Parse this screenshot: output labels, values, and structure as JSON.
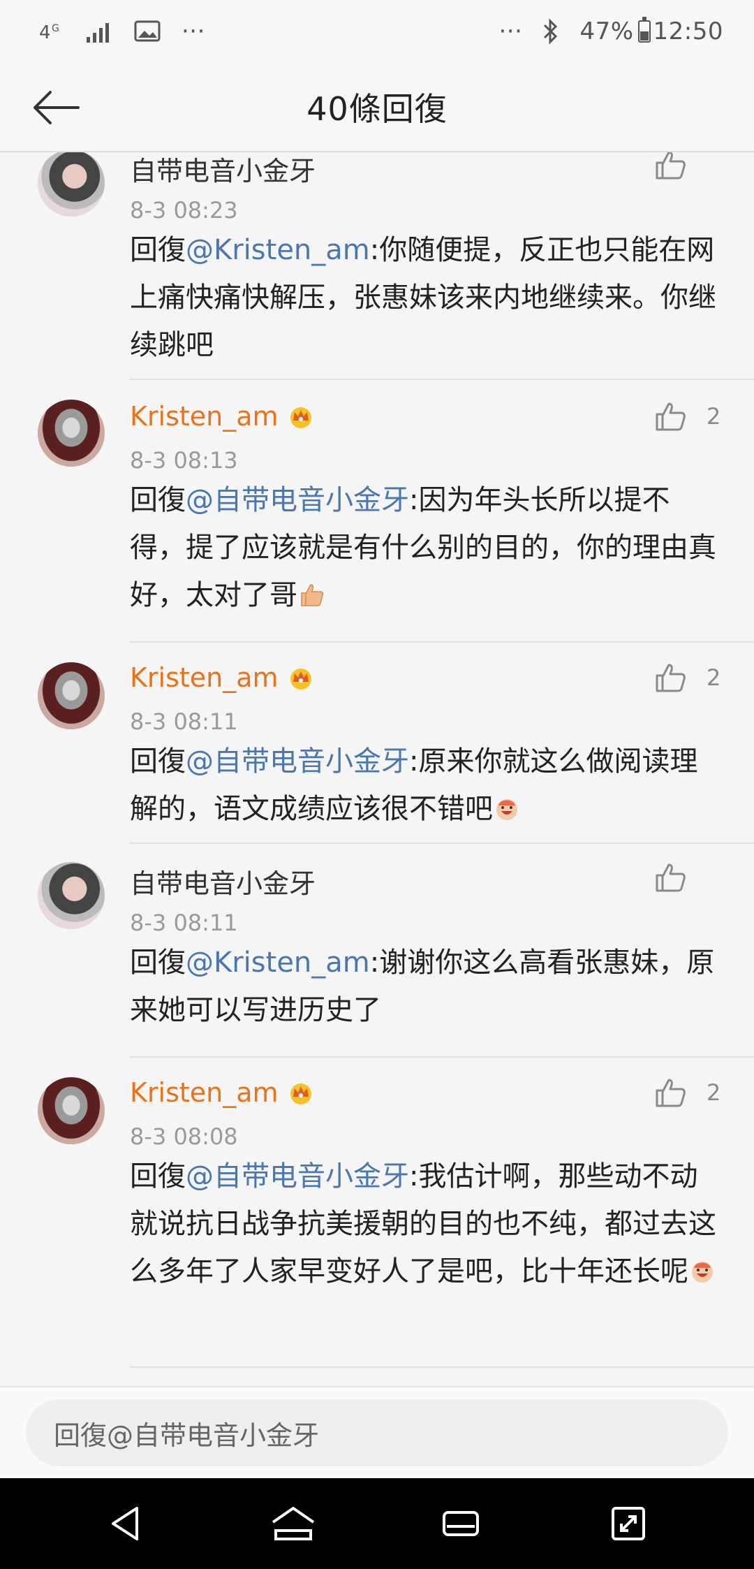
{
  "status_bar": {
    "network": "4G",
    "more": "···",
    "more_right": "···",
    "battery": "47%",
    "time": "12:50"
  },
  "header": {
    "title": "40條回復"
  },
  "comments": [
    {
      "name": "自带电音小金牙",
      "vip": false,
      "time": "8-3 08:23",
      "reply_prefix": "回復",
      "mention": "@Kristen_am",
      "body": ":你随便提，反正也只能在网上痛快痛快解压，张惠妹该来内地继续来。你继续跳吧",
      "likes": ""
    },
    {
      "name": "Kristen_am",
      "vip": true,
      "time": "8-3 08:13",
      "reply_prefix": "回復",
      "mention": "@自带电音小金牙",
      "body": ":因为年头长所以提不得，提了应该就是有什么别的目的，你的理由真好，太对了哥",
      "likes": "2"
    },
    {
      "name": "Kristen_am",
      "vip": true,
      "time": "8-3 08:11",
      "reply_prefix": "回復",
      "mention": "@自带电音小金牙",
      "body": ":原来你就这么做阅读理解的，语文成绩应该很不错吧",
      "likes": "2"
    },
    {
      "name": "自带电音小金牙",
      "vip": false,
      "time": "8-3 08:11",
      "reply_prefix": "回復",
      "mention": "@Kristen_am",
      "body": ":谢谢你这么高看张惠妹，原来她可以写进历史了",
      "likes": ""
    },
    {
      "name": "Kristen_am",
      "vip": true,
      "time": "8-3 08:08",
      "reply_prefix": "回復",
      "mention": "@自带电音小金牙",
      "body": ":我估计啊，那些动不动就说抗日战争抗美援朝的目的也不纯，都过去这么多年了人家早变好人了是吧，比十年还长呢",
      "likes": "2"
    }
  ],
  "reply_bar": {
    "placeholder": "回復@自带电音小金牙"
  },
  "icons": {
    "back": "arrow-left-icon",
    "like": "thumbs-up-icon",
    "crown": "crown-icon",
    "nav_back": "triangle-back-icon",
    "nav_home": "home-icon",
    "nav_recents": "recents-icon",
    "nav_expand": "expand-icon"
  },
  "colors": {
    "vip_name": "#e8731a",
    "mention": "#4a77b0",
    "time": "#9a9a9a"
  }
}
